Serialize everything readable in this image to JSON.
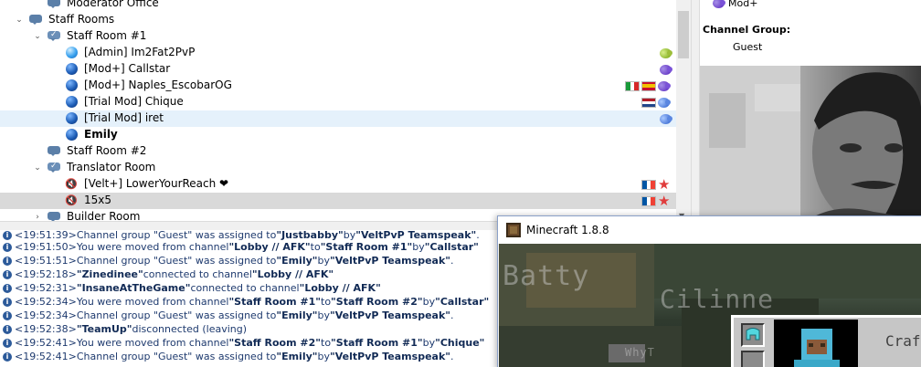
{
  "tree": {
    "rows": [
      {
        "label": "Moderator Office"
      },
      {
        "label": "Staff Rooms"
      },
      {
        "label": "Staff Room #1"
      },
      {
        "label": "[Admin] Im2Fat2PvP"
      },
      {
        "label": "[Mod+] Callstar"
      },
      {
        "label": "[Mod+] Naples_EscobarOG"
      },
      {
        "label": "[Trial Mod] Chique"
      },
      {
        "label": "[Trial Mod] iret"
      },
      {
        "label": "Emily"
      },
      {
        "label": "Staff Room #2"
      },
      {
        "label": "Translator Room"
      },
      {
        "label": "[Velt+] LowerYourReach ❤"
      },
      {
        "label": "15x5"
      },
      {
        "label": "Builder Room"
      }
    ]
  },
  "info": {
    "top_group": "Mod+",
    "channel_group_label": "Channel Group:",
    "channel_group_value": "Guest"
  },
  "log": [
    {
      "time": "<19:51:39>",
      "pre": " Channel group \"Guest\" was assigned to ",
      "b1": "\"Justbabby\"",
      "mid": " by ",
      "b2": "\"VeltPvP Teamspeak\"",
      "post": "."
    },
    {
      "time": "<19:51:50>",
      "pre": " You were moved from channel ",
      "b1": "\"Lobby // AFK\"",
      "mid": " to ",
      "b2": "\"Staff Room #1\"",
      "mid2": " by ",
      "b3": "\"Callstar\"",
      "post": ""
    },
    {
      "time": "<19:51:51>",
      "pre": " Channel group \"Guest\" was assigned to ",
      "b1": "\"Emily\"",
      "mid": " by ",
      "b2": "\"VeltPvP Teamspeak\"",
      "post": "."
    },
    {
      "time": "<19:52:18>",
      "pre": " ",
      "b1": "\"Zinedinee\"",
      "mid": " connected to channel ",
      "b2": "\"Lobby // AFK\"",
      "post": ""
    },
    {
      "time": "<19:52:31>",
      "pre": " ",
      "b1": "\"InsaneAtTheGame\"",
      "mid": " connected to channel ",
      "b2": "\"Lobby // AFK\"",
      "post": ""
    },
    {
      "time": "<19:52:34>",
      "pre": " You were moved from channel ",
      "b1": "\"Staff Room #1\"",
      "mid": " to ",
      "b2": "\"Staff Room #2\"",
      "mid2": " by ",
      "b3": "\"Callstar\"",
      "post": ""
    },
    {
      "time": "<19:52:34>",
      "pre": " Channel group \"Guest\" was assigned to ",
      "b1": "\"Emily\"",
      "mid": " by ",
      "b2": "\"VeltPvP Teamspeak\"",
      "post": "."
    },
    {
      "time": "<19:52:38>",
      "pre": " ",
      "b1": "\"TeamUp\"",
      "mid": " disconnected (leaving)",
      "b2": "",
      "post": ""
    },
    {
      "time": "<19:52:41>",
      "pre": " You were moved from channel ",
      "b1": "\"Staff Room #2\"",
      "mid": " to ",
      "b2": "\"Staff Room #1\"",
      "mid2": " by ",
      "b3": "\"Chique\"",
      "post": ""
    },
    {
      "time": "<19:52:41>",
      "pre": " Channel group \"Guest\" was assigned to ",
      "b1": "\"Emily\"",
      "mid": " by ",
      "b2": "\"VeltPvP Teamspeak\"",
      "post": "."
    }
  ],
  "minecraft": {
    "title": "Minecraft 1.8.8",
    "name1": "Batty",
    "name2": "Cilinne",
    "name3": "WhyT",
    "craft_label": "Craf"
  },
  "colors": {
    "selected_row": "#e5f1fb",
    "log_text": "#1e3a6e"
  }
}
